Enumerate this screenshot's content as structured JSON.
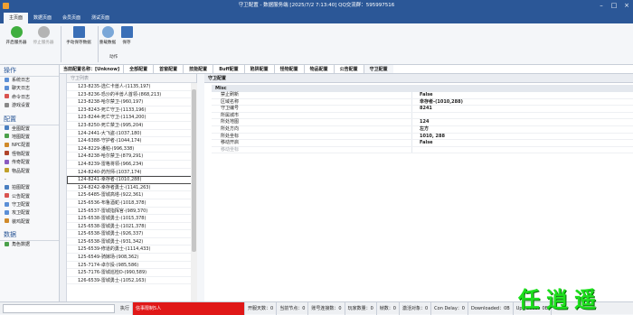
{
  "window": {
    "title": "守卫配置 - 数据服务端 [2025/7/2 7:13:40] QQ交流群：595997516"
  },
  "menu_tabs": [
    "主页面",
    "数据页面",
    "会员页面",
    "测试页面"
  ],
  "toolbar": {
    "buttons": [
      "开启服务器",
      "停止服务器",
      "手动保存数据",
      "重载数据",
      "保存"
    ],
    "group_label": "动作"
  },
  "sidebar": {
    "ops_header": "操作",
    "ops_items": [
      "系统日志",
      "聊天日志",
      "命令日志",
      "游戏设置"
    ],
    "config_header": "配置",
    "config_items": [
      "坐图配置",
      "地图配置",
      "NPC配置",
      "怪物配置",
      "传奇配置",
      "物品配置",
      "-",
      "拍图配置",
      "公告配置",
      "守卫配置",
      "攻卫配置",
      "装鸡配置"
    ],
    "data_header": "数据",
    "data_items": [
      "角色数据"
    ]
  },
  "top_strip": {
    "caption": "当前配置名称：[Unknow]",
    "tabs": [
      "全部配置",
      "首窗配置",
      "技能配置",
      "Buff配置",
      "陷阱配置",
      "怪物配置",
      "物品配置",
      "公告配置",
      "守卫配置"
    ],
    "active_tab": "守卫配置"
  },
  "list_panel": {
    "header": "守卫列表",
    "items": [
      "123-8235-选仁卡兽人-(1135,197)",
      "123-8236-恐沙的半兽人首领-(868,213)",
      "123-8238-哈尔禁卫-(960,197)",
      "123-8243-死亡守卫-(1133,196)",
      "123-8244-死亡守卫-(1134,200)",
      "123-8250-死亡禁卫-(995,204)",
      "124-2441-大飞盗-(1037,180)",
      "124-6388-守护者-(1044,174)",
      "124-8229-潘帕-(996,338)",
      "124-8238-哈尔禁卫-(879,291)",
      "124-8239-雷格将领-(966,234)",
      "124-8240-药剂师-(1037,174)",
      "124-8241-幸存者-(1010,288)",
      "124-8242-幸存者勇士-(1141,263)",
      "125-6485-雷城高塔-(922,361)",
      "125-6536-布鲁酒蛇-(1018,378)",
      "125-6537-雷城指挥官-(989,370)",
      "125-6538-雷城勇士-(1015,378)",
      "125-6538-雷城勇士-(1021,378)",
      "125-6538-雷城勇士-(926,337)",
      "125-6538-雷城勇士-(931,342)",
      "125-6539-修道的勇士-(1114,433)",
      "125-6549-骑嫁场-(908,362)",
      "125-7174-卓尔投-(985,586)",
      "125-7176-雷城巡检D-(990,589)",
      "126-6539-雷城勇士-(1052,163)"
    ],
    "selected_index": 12
  },
  "prop_panel": {
    "header": "守卫配置",
    "category": "Misc",
    "rows": [
      {
        "key": "禁止刷新",
        "value": "False",
        "muted": false
      },
      {
        "key": "区域名称",
        "value": "幸存者-(1010,288)",
        "muted": false
      },
      {
        "key": "守卫编号",
        "value": "8241",
        "muted": false
      },
      {
        "key": "所属城市",
        "value": "",
        "muted": false
      },
      {
        "key": "所处地图",
        "value": "124",
        "muted": false
      },
      {
        "key": "所处方向",
        "value": "左方",
        "muted": false
      },
      {
        "key": "所处坐标",
        "value": "1010, 288",
        "muted": false
      },
      {
        "key": "移动开启",
        "value": "False",
        "muted": false
      },
      {
        "key": "移动坐标",
        "value": "",
        "muted": true
      }
    ]
  },
  "status_bar": {
    "exec_label": "执行",
    "alert": "信事限制5人",
    "stats": [
      "开服天数：0",
      "当前节点：0",
      "账号连接数：0",
      "玩家数量：0",
      "帧数：0",
      "激活对象：0",
      "Con Delay：0",
      "Downloaded：0B",
      "Uploaded：0B"
    ],
    "logo_text": "任逍遥"
  },
  "colors": {
    "title_blue": "#2b5797",
    "alert_red": "#e01818",
    "logo_green": "#1ee01e"
  }
}
